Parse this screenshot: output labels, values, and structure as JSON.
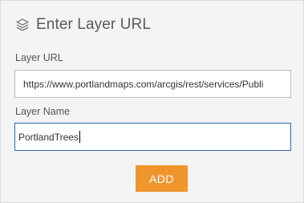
{
  "header": {
    "title": "Enter Layer URL",
    "icon": "layers-icon"
  },
  "form": {
    "url_label": "Layer URL",
    "url_value": "https://www.portlandmaps.com/arcgis/rest/services/Publi",
    "name_label": "Layer Name",
    "name_value": "PortlandTrees"
  },
  "actions": {
    "add_label": "ADD"
  },
  "colors": {
    "accent": "#f0952c",
    "focus_border": "#2c67a8",
    "panel_bg": "#f4f4f4"
  }
}
